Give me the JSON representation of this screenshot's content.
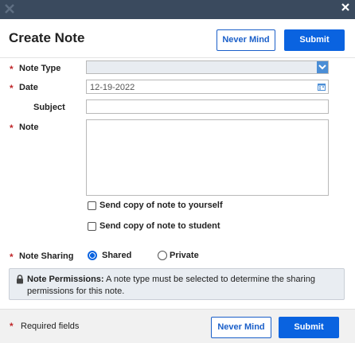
{
  "dialog": {
    "title": "Create Note",
    "header_buttons": {
      "cancel_label": "Never Mind",
      "submit_label": "Submit"
    }
  },
  "form": {
    "required_marker": "*",
    "note_type": {
      "label": "Note Type",
      "value": ""
    },
    "date": {
      "label": "Date",
      "value": "12-19-2022"
    },
    "subject": {
      "label": "Subject",
      "value": ""
    },
    "note": {
      "label": "Note",
      "value": ""
    },
    "options": {
      "copy_self_label": "Send copy of note to yourself",
      "copy_self_checked": false,
      "copy_student_label": "Send copy of note to student",
      "copy_student_checked": false
    },
    "sharing": {
      "label": "Note Sharing",
      "options": [
        {
          "label": "Shared",
          "selected": true
        },
        {
          "label": "Private",
          "selected": false
        }
      ]
    },
    "permissions": {
      "title": "Note Permissions:",
      "message": "A note type must be selected to determine the sharing permissions for this note."
    }
  },
  "footer": {
    "required_text": "Required fields",
    "cancel_label": "Never Mind",
    "submit_label": "Submit"
  },
  "colors": {
    "accent": "#0a63e0",
    "required": "#c0282b",
    "titlebar": "#3a4a5e"
  },
  "icons": [
    "app-logo-icon",
    "close-icon",
    "chevron-down-icon",
    "calendar-icon",
    "lock-icon"
  ]
}
